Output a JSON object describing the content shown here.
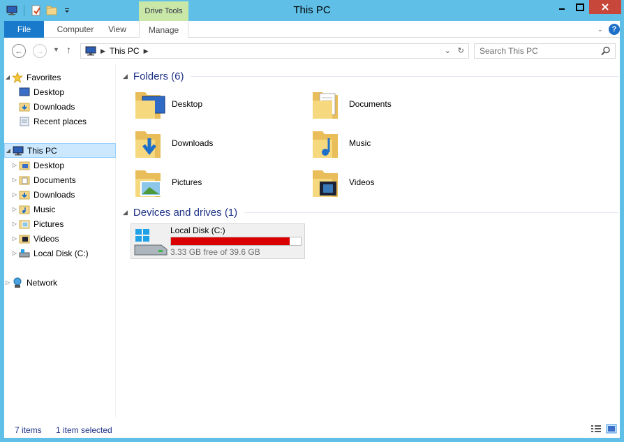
{
  "window": {
    "title": "This PC",
    "contextual_tab": "Drive Tools"
  },
  "ribbon": {
    "tabs": [
      "File",
      "Computer",
      "View",
      "Manage"
    ]
  },
  "address": {
    "path": "This PC",
    "search_placeholder": "Search This PC"
  },
  "navpane": {
    "favorites": "Favorites",
    "fav_items": [
      "Desktop",
      "Downloads",
      "Recent places"
    ],
    "this_pc": "This PC",
    "pc_items": [
      "Desktop",
      "Documents",
      "Downloads",
      "Music",
      "Pictures",
      "Videos",
      "Local Disk (C:)"
    ],
    "network": "Network"
  },
  "folders": {
    "header": "Folders (6)",
    "items": [
      "Desktop",
      "Documents",
      "Downloads",
      "Music",
      "Pictures",
      "Videos"
    ]
  },
  "drives": {
    "header": "Devices and drives (1)",
    "items": [
      {
        "name": "Local Disk (C:)",
        "free_text": "3.33 GB free of 39.6 GB",
        "used_fraction": 0.916
      }
    ]
  },
  "status": {
    "items_count": "7 items",
    "selection": "1 item selected"
  },
  "colors": {
    "accent": "#1979ca",
    "titlebar": "#5fbfe6",
    "drive_bar": "#da0000",
    "group_header": "#1e3287"
  }
}
